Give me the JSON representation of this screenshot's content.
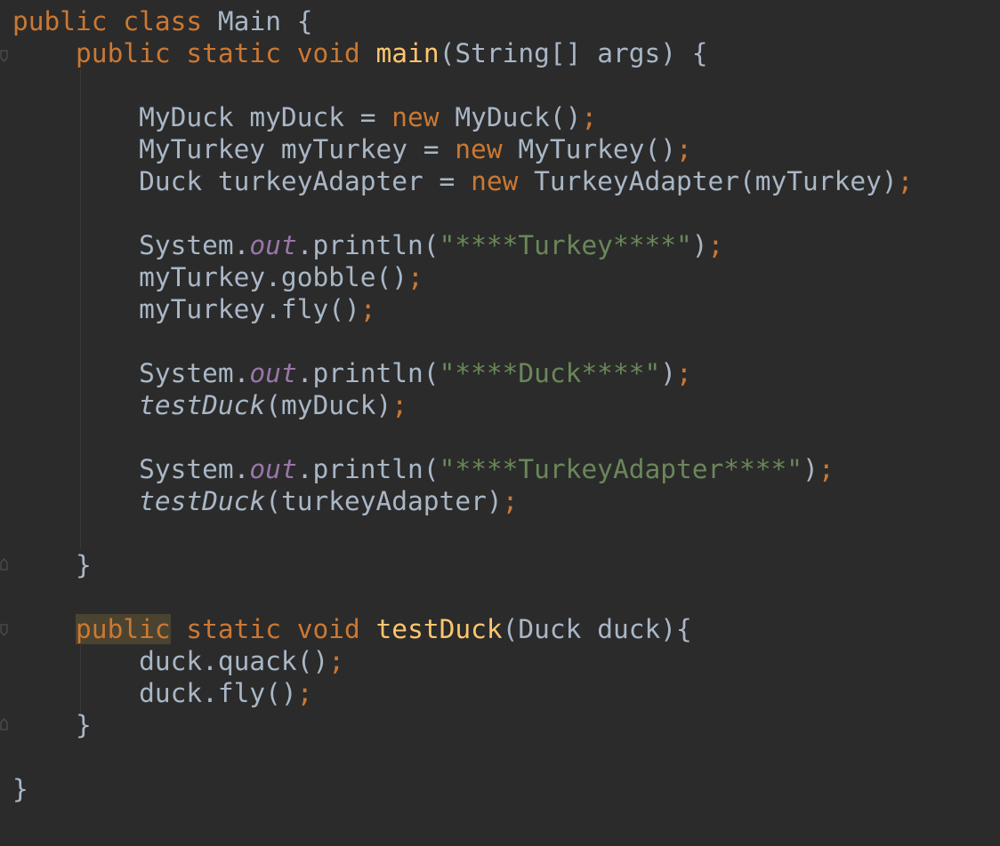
{
  "editor": {
    "theme": {
      "background": "#2b2b2b",
      "default_text": "#a9b7c6",
      "keyword": "#cc7832",
      "string": "#6a8759",
      "method_declaration": "#ffc66d",
      "static_field": "#9876aa",
      "highlight_background": "#4a4330"
    },
    "lines": [
      {
        "tokens": [
          {
            "t": "public",
            "c": "kw"
          },
          {
            "t": " ",
            "c": "id"
          },
          {
            "t": "class",
            "c": "kw"
          },
          {
            "t": " Main {",
            "c": "id"
          }
        ]
      },
      {
        "tokens": [
          {
            "t": "    ",
            "c": "id"
          },
          {
            "t": "public",
            "c": "kw"
          },
          {
            "t": " ",
            "c": "id"
          },
          {
            "t": "static",
            "c": "kw"
          },
          {
            "t": " ",
            "c": "id"
          },
          {
            "t": "void",
            "c": "kw"
          },
          {
            "t": " ",
            "c": "id"
          },
          {
            "t": "main",
            "c": "fn"
          },
          {
            "t": "(String[] args) {",
            "c": "id"
          }
        ]
      },
      {
        "tokens": []
      },
      {
        "tokens": [
          {
            "t": "        MyDuck myDuck = ",
            "c": "id"
          },
          {
            "t": "new",
            "c": "kw"
          },
          {
            "t": " MyDuck()",
            "c": "id"
          },
          {
            "t": ";",
            "c": "semi"
          }
        ]
      },
      {
        "tokens": [
          {
            "t": "        MyTurkey myTurkey = ",
            "c": "id"
          },
          {
            "t": "new",
            "c": "kw"
          },
          {
            "t": " MyTurkey()",
            "c": "id"
          },
          {
            "t": ";",
            "c": "semi"
          }
        ]
      },
      {
        "tokens": [
          {
            "t": "        Duck turkeyAdapter = ",
            "c": "id"
          },
          {
            "t": "new",
            "c": "kw"
          },
          {
            "t": " TurkeyAdapter(myTurkey)",
            "c": "id"
          },
          {
            "t": ";",
            "c": "semi"
          }
        ]
      },
      {
        "tokens": []
      },
      {
        "tokens": [
          {
            "t": "        System.",
            "c": "id"
          },
          {
            "t": "out",
            "c": "field"
          },
          {
            "t": ".println(",
            "c": "id"
          },
          {
            "t": "\"****Turkey****\"",
            "c": "str"
          },
          {
            "t": ")",
            "c": "id"
          },
          {
            "t": ";",
            "c": "semi"
          }
        ]
      },
      {
        "tokens": [
          {
            "t": "        myTurkey.gobble()",
            "c": "id"
          },
          {
            "t": ";",
            "c": "semi"
          }
        ]
      },
      {
        "tokens": [
          {
            "t": "        myTurkey.fly()",
            "c": "id"
          },
          {
            "t": ";",
            "c": "semi"
          }
        ]
      },
      {
        "tokens": []
      },
      {
        "tokens": [
          {
            "t": "        System.",
            "c": "id"
          },
          {
            "t": "out",
            "c": "field"
          },
          {
            "t": ".println(",
            "c": "id"
          },
          {
            "t": "\"****Duck****\"",
            "c": "str"
          },
          {
            "t": ")",
            "c": "id"
          },
          {
            "t": ";",
            "c": "semi"
          }
        ]
      },
      {
        "tokens": [
          {
            "t": "        ",
            "c": "id"
          },
          {
            "t": "testDuck",
            "c": "static-call"
          },
          {
            "t": "(myDuck)",
            "c": "id"
          },
          {
            "t": ";",
            "c": "semi"
          }
        ]
      },
      {
        "tokens": []
      },
      {
        "tokens": [
          {
            "t": "        System.",
            "c": "id"
          },
          {
            "t": "out",
            "c": "field"
          },
          {
            "t": ".println(",
            "c": "id"
          },
          {
            "t": "\"****TurkeyAdapter****\"",
            "c": "str"
          },
          {
            "t": ")",
            "c": "id"
          },
          {
            "t": ";",
            "c": "semi"
          }
        ]
      },
      {
        "tokens": [
          {
            "t": "        ",
            "c": "id"
          },
          {
            "t": "testDuck",
            "c": "static-call"
          },
          {
            "t": "(turkeyAdapter)",
            "c": "id"
          },
          {
            "t": ";",
            "c": "semi"
          }
        ]
      },
      {
        "tokens": []
      },
      {
        "tokens": [
          {
            "t": "    }",
            "c": "id"
          }
        ]
      },
      {
        "tokens": []
      },
      {
        "tokens": [
          {
            "t": "    ",
            "c": "id"
          },
          {
            "t": "public",
            "c": "kw-hl"
          },
          {
            "t": " ",
            "c": "id"
          },
          {
            "t": "static",
            "c": "kw"
          },
          {
            "t": " ",
            "c": "id"
          },
          {
            "t": "void",
            "c": "kw"
          },
          {
            "t": " ",
            "c": "id"
          },
          {
            "t": "testDuck",
            "c": "fn"
          },
          {
            "t": "(Duck duck){",
            "c": "id"
          }
        ]
      },
      {
        "tokens": [
          {
            "t": "        duck.quack()",
            "c": "id"
          },
          {
            "t": ";",
            "c": "semi"
          }
        ]
      },
      {
        "tokens": [
          {
            "t": "        duck.fly()",
            "c": "id"
          },
          {
            "t": ";",
            "c": "semi"
          }
        ]
      },
      {
        "tokens": [
          {
            "t": "    }",
            "c": "id"
          }
        ]
      },
      {
        "tokens": []
      },
      {
        "tokens": [
          {
            "t": "}",
            "c": "id"
          }
        ]
      }
    ]
  }
}
